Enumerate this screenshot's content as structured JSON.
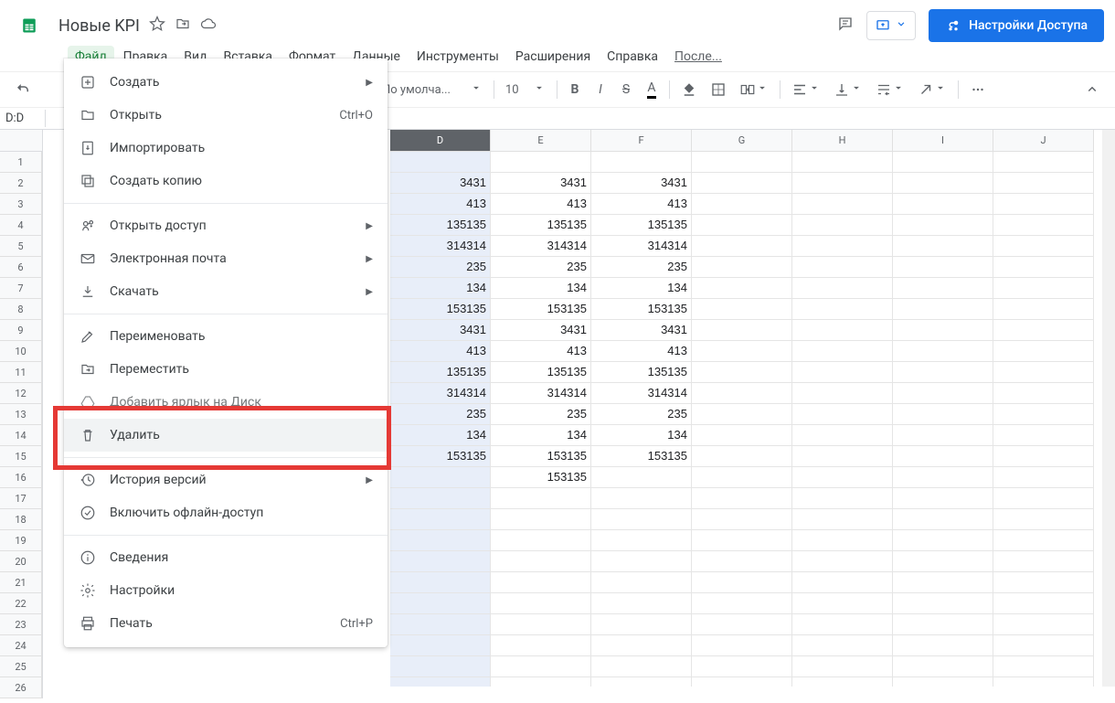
{
  "doc": {
    "title": "Новые KPI"
  },
  "menus": {
    "file": "Файл",
    "edit": "Правка",
    "view": "Вид",
    "insert": "Вставка",
    "format": "Формат",
    "data": "Данные",
    "tools": "Инструменты",
    "extensions": "Расширения",
    "help": "Справка",
    "last_edit": "После..."
  },
  "share_button": "Настройки Доступа",
  "toolbar": {
    "font": "По умолча...",
    "size": "10"
  },
  "name_box": "D:D",
  "columns": [
    "D",
    "E",
    "F",
    "G",
    "H",
    "I",
    "J"
  ],
  "row_count": 26,
  "selected_column_index": 0,
  "sheet_data": {
    "D": [
      "",
      "3431",
      "413",
      "135135",
      "314314",
      "235",
      "134",
      "153135",
      "3431",
      "413",
      "135135",
      "314314",
      "235",
      "134",
      "153135"
    ],
    "E": [
      "",
      "3431",
      "413",
      "135135",
      "314314",
      "235",
      "134",
      "153135",
      "3431",
      "413",
      "135135",
      "314314",
      "235",
      "134",
      "153135",
      "153135"
    ],
    "F": [
      "",
      "3431",
      "413",
      "135135",
      "314314",
      "235",
      "134",
      "153135",
      "3431",
      "413",
      "135135",
      "314314",
      "235",
      "134",
      "153135"
    ]
  },
  "file_menu": [
    {
      "icon": "plus-box",
      "label": "Создать",
      "submenu": true
    },
    {
      "icon": "folder",
      "label": "Открыть",
      "shortcut": "Ctrl+O"
    },
    {
      "icon": "import",
      "label": "Импортировать"
    },
    {
      "icon": "copy",
      "label": "Создать копию"
    },
    {
      "sep": true
    },
    {
      "icon": "share",
      "label": "Открыть доступ",
      "submenu": true
    },
    {
      "icon": "mail",
      "label": "Электронная почта",
      "submenu": true
    },
    {
      "icon": "download",
      "label": "Скачать",
      "submenu": true
    },
    {
      "sep": true
    },
    {
      "icon": "rename",
      "label": "Переименовать"
    },
    {
      "icon": "move",
      "label": "Переместить"
    },
    {
      "icon": "drive",
      "label": "Добавить ярлык на Диск",
      "obscured": true
    },
    {
      "icon": "trash",
      "label": "Удалить",
      "hovered": true
    },
    {
      "sep": true
    },
    {
      "icon": "history",
      "label": "История версий",
      "submenu": true
    },
    {
      "icon": "offline",
      "label": "Включить офлайн-доступ"
    },
    {
      "sep": true
    },
    {
      "icon": "info",
      "label": "Сведения"
    },
    {
      "icon": "gear",
      "label": "Настройки"
    },
    {
      "icon": "print",
      "label": "Печать",
      "shortcut": "Ctrl+P"
    }
  ]
}
